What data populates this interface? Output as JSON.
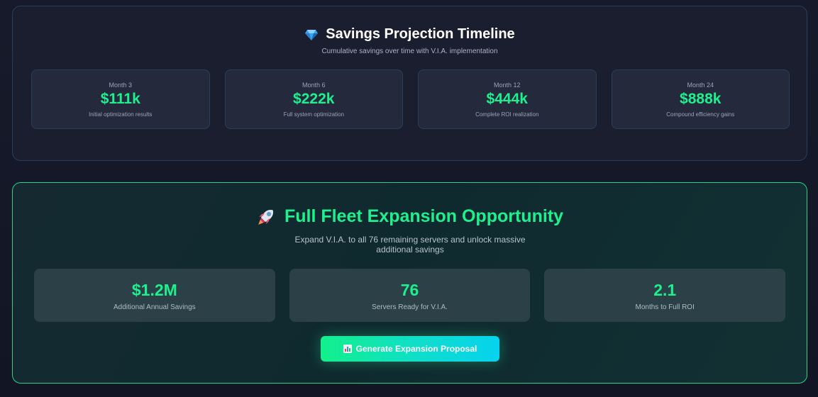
{
  "projection": {
    "title": "Savings Projection Timeline",
    "title_icon": "gem-icon",
    "subtitle": "Cumulative savings over time with V.I.A. implementation",
    "milestones": [
      {
        "label": "Month 3",
        "value": "$111k",
        "description": "Initial optimization results"
      },
      {
        "label": "Month 6",
        "value": "$222k",
        "description": "Full system optimization"
      },
      {
        "label": "Month 12",
        "value": "$444k",
        "description": "Complete ROI realization"
      },
      {
        "label": "Month 24",
        "value": "$888k",
        "description": "Compound efficiency gains"
      }
    ]
  },
  "expansion": {
    "title": "Full Fleet Expansion Opportunity",
    "title_icon": "rocket-icon",
    "subtitle": "Expand V.I.A. to all 76 remaining servers and unlock massive additional savings",
    "stats": [
      {
        "value": "$1.2M",
        "label": "Additional Annual Savings"
      },
      {
        "value": "76",
        "label": "Servers Ready for V.I.A."
      },
      {
        "value": "2.1",
        "label": "Months to Full ROI"
      }
    ],
    "cta_label": "Generate Expansion Proposal",
    "cta_icon": "bar-chart-icon"
  },
  "colors": {
    "accent_green": "#1ef08e",
    "accent_cyan": "#06d3ee",
    "card_border": "#25405a",
    "expansion_border": "#1fd786"
  }
}
